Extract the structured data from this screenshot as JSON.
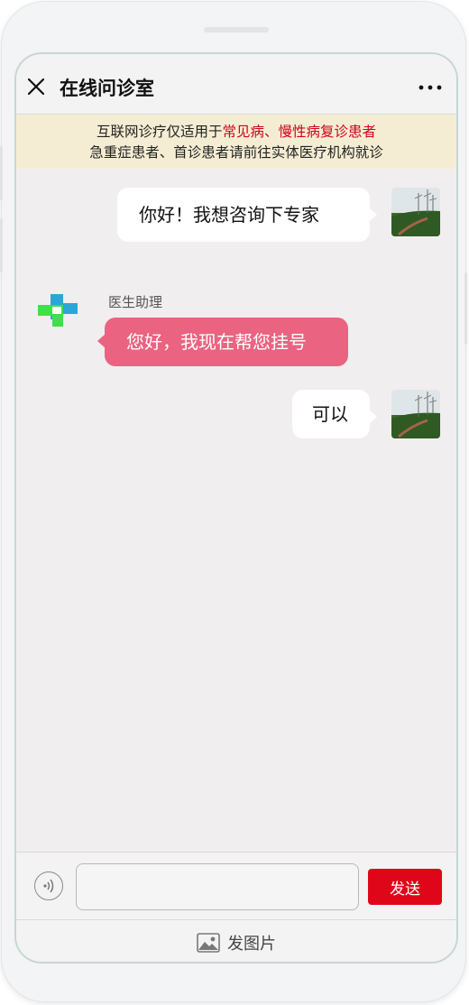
{
  "header": {
    "title": "在线问诊室",
    "close_icon": "close-icon",
    "more_icon": "more-dots-icon"
  },
  "notice": {
    "line1_prefix": "互联网诊疗仅适用于",
    "line1_highlight": "常见病、慢性病复诊患者",
    "line2": "急重症患者、首诊患者请前往实体医疗机构就诊",
    "highlight_color": "#d0021b"
  },
  "messages": [
    {
      "side": "right",
      "text": "你好！我想咨询下专家",
      "avatar": "user-landscape-avatar"
    },
    {
      "side": "left",
      "sender": "医生助理",
      "text": "您好，我现在帮您挂号",
      "avatar": "doctor-cross-logo"
    },
    {
      "side": "right",
      "text": "可以",
      "avatar": "user-landscape-avatar"
    }
  ],
  "composer": {
    "voice_icon": "voice-icon",
    "input_value": "",
    "input_placeholder": "",
    "send_label": "发送",
    "send_color": "#e0061a",
    "send_image_label": "发图片",
    "send_image_icon": "image-icon"
  },
  "colors": {
    "doctor_bubble": "#ea6381",
    "notice_bg": "#f4edd3"
  }
}
